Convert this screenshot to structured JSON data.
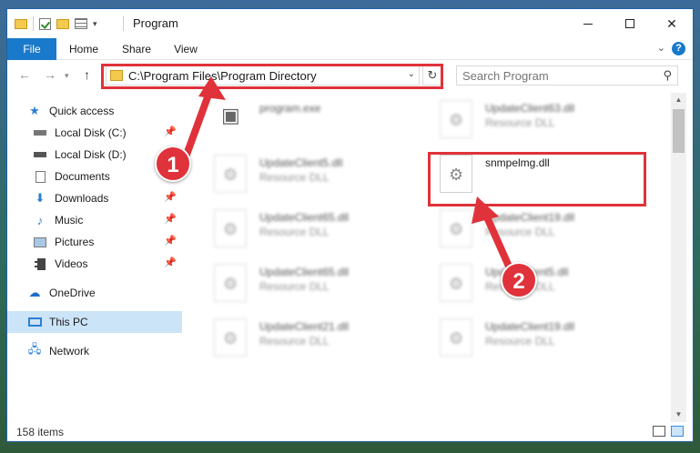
{
  "window": {
    "title": "Program",
    "controls": {
      "minimize": "minimize",
      "maximize": "maximize",
      "close": "✕"
    }
  },
  "ribbon": {
    "tabs": [
      "File",
      "Home",
      "Share",
      "View"
    ],
    "help": "?"
  },
  "address": {
    "path": "C:\\Program Files\\Program Directory",
    "search_placeholder": "Search Program"
  },
  "sidebar": {
    "items": [
      {
        "label": "Quick access",
        "icon": "star-icon",
        "pinned": false
      },
      {
        "label": "Local Disk (C:)",
        "icon": "drive-icon",
        "pinned": true
      },
      {
        "label": "Local Disk (D:)",
        "icon": "drive-icon",
        "pinned": true
      },
      {
        "label": "Documents",
        "icon": "documents-icon",
        "pinned": true
      },
      {
        "label": "Downloads",
        "icon": "download-icon",
        "pinned": true
      },
      {
        "label": "Music",
        "icon": "music-icon",
        "pinned": true
      },
      {
        "label": "Pictures",
        "icon": "pictures-icon",
        "pinned": true
      },
      {
        "label": "Videos",
        "icon": "videos-icon",
        "pinned": true
      },
      {
        "label": "OneDrive",
        "icon": "cloud-icon",
        "pinned": false
      },
      {
        "label": "This PC",
        "icon": "computer-icon",
        "pinned": false,
        "selected": true
      },
      {
        "label": "Network",
        "icon": "network-icon",
        "pinned": false
      }
    ]
  },
  "files": [
    {
      "name": "program.exe",
      "type": ""
    },
    {
      "name": "UpdateClient63.dll",
      "type": "Resource DLL"
    },
    {
      "name": "UpdateClient5.dll",
      "type": "Resource DLL"
    },
    {
      "name": "snmpelmg.dll",
      "type": ""
    },
    {
      "name": "UpdateClient65.dll",
      "type": "Resource DLL"
    },
    {
      "name": "UpdateClient19.dll",
      "type": "Resource DLL"
    },
    {
      "name": "UpdateClient65.dll",
      "type": "Resource DLL"
    },
    {
      "name": "UpdateClient5.dll",
      "type": "Resource DLL"
    },
    {
      "name": "UpdateClient21.dll",
      "type": "Resource DLL"
    },
    {
      "name": "UpdateClient19.dll",
      "type": "Resource DLL"
    }
  ],
  "status": {
    "items": "158 items"
  },
  "callouts": {
    "one": "1",
    "two": "2"
  },
  "colors": {
    "accent": "#1979ca",
    "callout": "#e0323a",
    "selected": "#cce4f7"
  }
}
